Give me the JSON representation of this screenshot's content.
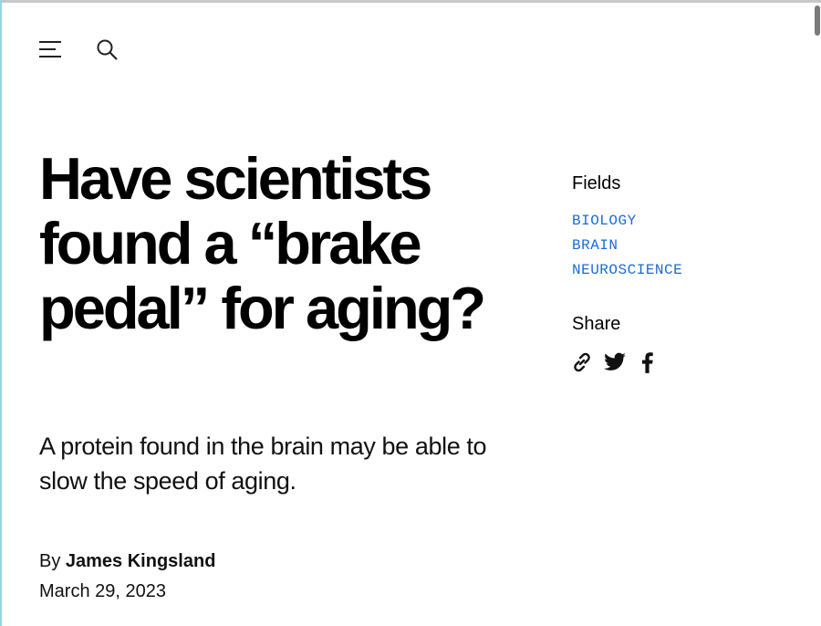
{
  "header": {
    "menu_icon": "hamburger-menu-icon",
    "search_icon": "search-icon"
  },
  "article": {
    "headline": "Have scientists found a “brake pedal” for aging?",
    "subtitle": "A protein found in the brain may be able to slow the speed of aging.",
    "byline_prefix": "By",
    "author": "James Kingsland",
    "date": "March 29, 2023"
  },
  "sidebar": {
    "fields_heading": "Fields",
    "fields": [
      "BIOLOGY",
      "BRAIN",
      "NEUROSCIENCE"
    ],
    "share_heading": "Share",
    "share_icons": [
      "link-icon",
      "twitter-icon",
      "facebook-icon"
    ]
  },
  "colors": {
    "field_link": "#1a6bd8",
    "text": "#000000"
  }
}
